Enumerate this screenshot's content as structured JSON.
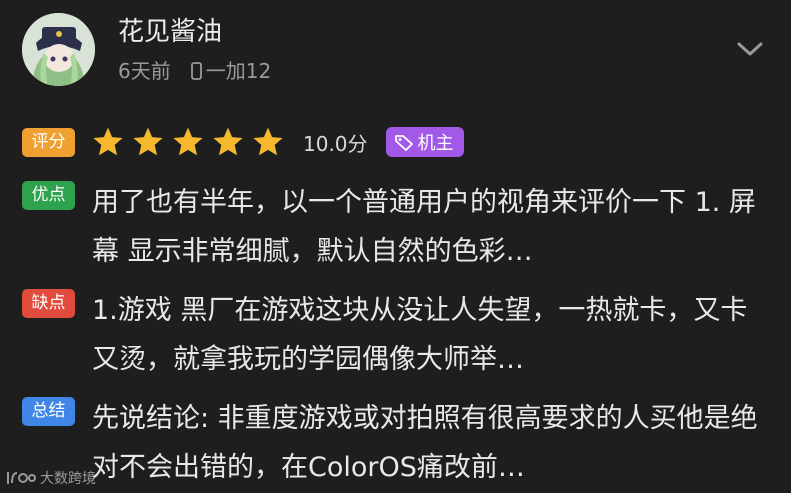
{
  "review": {
    "username": "花见酱油",
    "time": "6天前",
    "device": "一加12",
    "rating_label": "评分",
    "rating_stars": 5,
    "rating_max_stars": 5,
    "score": "10.0分",
    "owner_badge": "机主",
    "pros_label": "优点",
    "pros_text": "用了也有半年，以一个普通用户的视角来评价一下 1. 屏幕 显示非常细腻，默认自然的色彩…",
    "cons_label": "缺点",
    "cons_text": "1.游戏 黑厂在游戏这块从没让人失望，一热就卡，又卡又烫，就拿我玩的学园偶像大师举…",
    "summary_label": "总结",
    "summary_text": "先说结论: 非重度游戏或对拍照有很高要求的人买他是绝对不会出错的，在ColorOS痛改前…"
  },
  "watermark": {
    "text": "大数跨境"
  },
  "colors": {
    "background": "#1e1e1e",
    "star": "#f5b82e",
    "tag_rating": "#f0a030",
    "tag_pros": "#2fa24e",
    "tag_cons": "#e04b3c",
    "tag_summary": "#3f86e6",
    "owner_badge": "#a259e8"
  },
  "icons": {
    "avatar": "avatar-image",
    "expand": "chevron-down-icon",
    "device": "phone-icon",
    "badge": "tag-icon",
    "star": "star-icon"
  }
}
